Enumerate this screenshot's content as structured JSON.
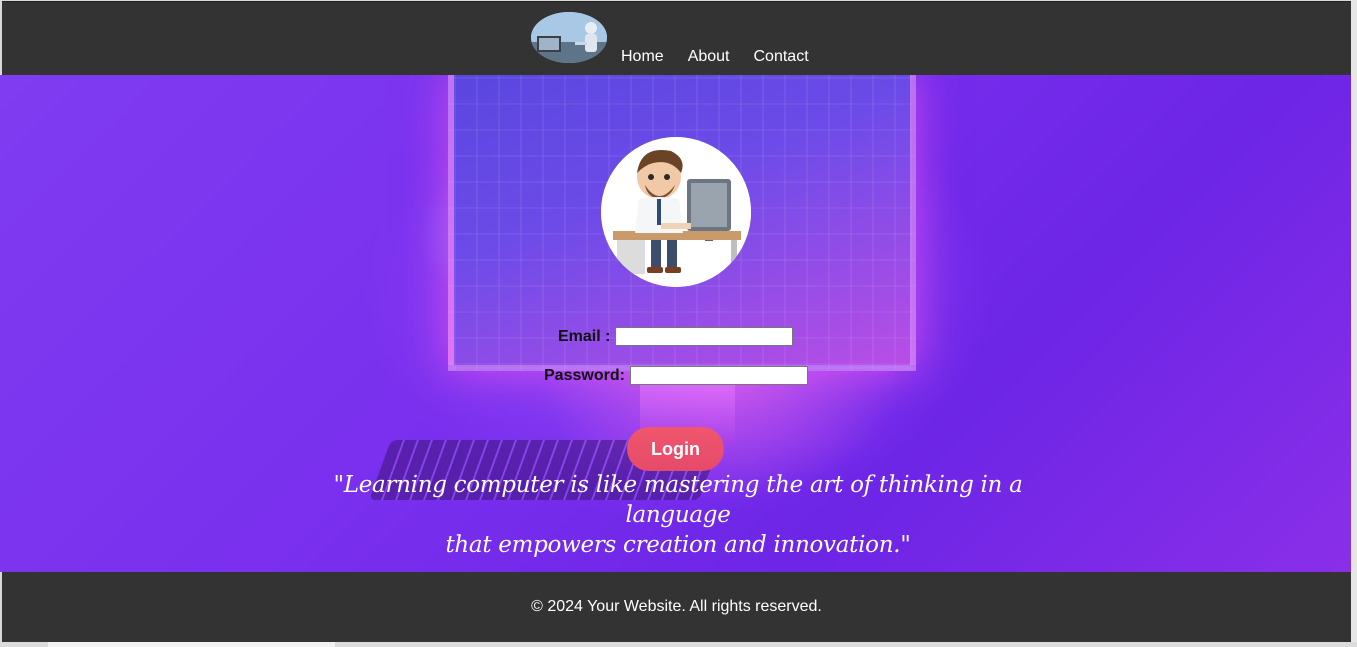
{
  "header": {
    "logo_icon": "robot-at-laptop-logo",
    "nav": {
      "home": "Home",
      "about": "About",
      "contact": "Contact"
    }
  },
  "hero": {
    "background_icon": "glowing-computer-circuit-background",
    "avatar_icon": "cartoon-man-at-computer-avatar",
    "form": {
      "email_label": "Email :",
      "email_value": "",
      "password_label": "Password:",
      "password_value": "",
      "login_label": "Login"
    },
    "quote_line1": "\"Learning computer is like mastering the art of thinking in a language",
    "quote_line2": "that empowers creation and innovation.\""
  },
  "footer": {
    "text": "© 2024 Your Website. All rights reserved."
  },
  "colors": {
    "header_bg": "#333333",
    "footer_bg": "#333333",
    "login_button": "#ec5169",
    "hero_purple": "#7a30ee"
  }
}
